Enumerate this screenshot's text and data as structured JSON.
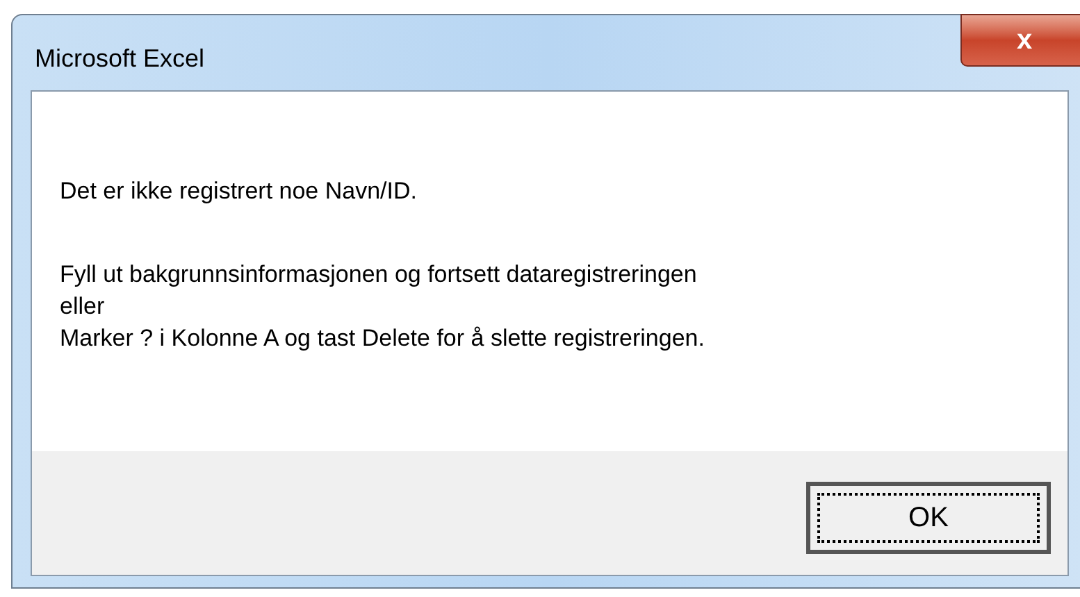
{
  "window": {
    "title": "Microsoft Excel",
    "close_label": "x"
  },
  "message": [
    "Det er ikke registrert noe Navn/ID.",
    "Fyll ut bakgrunnsinformasjonen og fortsett dataregistreringen",
    "eller",
    "Marker ? i Kolonne A og tast Delete for å slette registreringen."
  ],
  "buttons": [
    {
      "label": "OK",
      "focused": true
    }
  ]
}
